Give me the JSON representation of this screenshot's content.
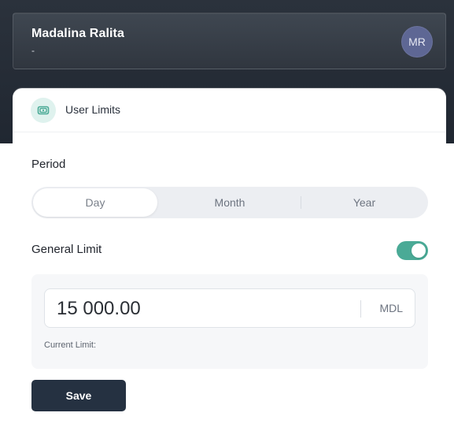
{
  "header": {
    "name": "Madalina Ralita",
    "subtitle": "-",
    "avatar_initials": "MR"
  },
  "panel": {
    "title": "User Limits",
    "title_icon": "wallet-icon"
  },
  "period": {
    "label": "Period",
    "options": [
      "Day",
      "Month",
      "Year"
    ],
    "selected": "Day"
  },
  "general_limit": {
    "label": "General Limit",
    "enabled": true,
    "amount": "15 000.00",
    "currency": "MDL",
    "current_limit_label": "Current Limit:"
  },
  "actions": {
    "save_label": "Save"
  },
  "colors": {
    "header_bg": "#2b323c",
    "avatar_bg": "#5e6794",
    "toggle_on": "#4aaa96",
    "save_bg": "#253141",
    "icon_bg": "#dff2ee"
  }
}
